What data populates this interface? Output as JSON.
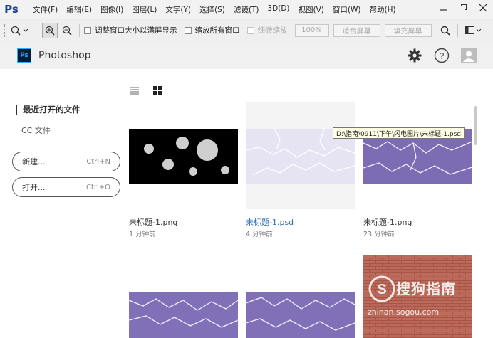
{
  "menubar": {
    "logo": "Ps",
    "items": [
      "文件(F)",
      "编辑(E)",
      "图像(I)",
      "图层(L)",
      "文字(Y)",
      "选择(S)",
      "滤镜(T)",
      "3D(D)",
      "视图(V)",
      "窗口(W)",
      "帮助(H)"
    ]
  },
  "options": {
    "resize_windows": "调整窗口大小以满屏显示",
    "zoom_all": "缩放所有窗口",
    "scrubby_zoom": "细微缩放",
    "percent": "100%",
    "fit_screen": "适合屏幕",
    "fill_screen": "填充屏幕"
  },
  "header": {
    "badge": "Ps",
    "title": "Photoshop"
  },
  "sidebar": {
    "recent": "最近打开的文件",
    "cc_files": "CC 文件",
    "new_label": "新建...",
    "new_shortcut": "Ctrl+N",
    "open_label": "打开...",
    "open_shortcut": "Ctrl+O"
  },
  "tooltip": "D:\\指南\\0911\\下午\\闪电图片\\未标题-1.psd",
  "files": [
    {
      "name": "未标题-1.png",
      "time": "1 分钟前",
      "kind": "chrome-texture"
    },
    {
      "name": "未标题-1.psd",
      "time": "4 分钟前",
      "kind": "white-lightning"
    },
    {
      "name": "未标题-1.png",
      "time": "23 分钟前",
      "kind": "purple-lightning"
    },
    {
      "name": "",
      "time": "",
      "kind": "purple-lightning"
    },
    {
      "name": "",
      "time": "",
      "kind": "purple-lightning"
    },
    {
      "name": "",
      "time": "",
      "kind": "brick-wall"
    }
  ],
  "watermark": {
    "brand": "搜狗指南",
    "url": "zhinan.sogou.com"
  },
  "colors": {
    "ps_blue": "#31a8ff",
    "ps_dark": "#001d34",
    "link": "#2d6fb3",
    "lightning_purple": "#3a2a7a",
    "brick": "#b0604e"
  }
}
